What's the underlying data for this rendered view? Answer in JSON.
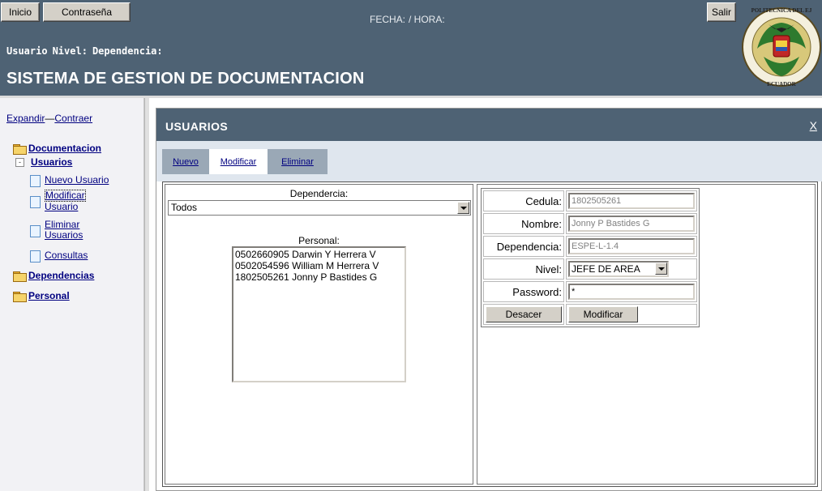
{
  "header": {
    "inicio_label": "Inicio",
    "password_label": "Contraseña",
    "fecha_label": "FECHA:",
    "hora_label": "/ HORA:",
    "salir_label": "Salir",
    "user_label": "Usuario",
    "nivel_label": "Nivel:",
    "dependencia_label": "Dependencia:",
    "system_title": "SISTEMA DE GESTION DE DOCUMENTACION",
    "logo_top_text": "POLITECNICA DEL EJ",
    "logo_bottom_text": "ECUADOR"
  },
  "sidebar": {
    "expandir": "Expandir",
    "dash": "—",
    "contraer": "Contraer",
    "documentacion": "Documentacion",
    "usuarios": "Usuarios",
    "nuevo_usuario": "Nuevo Usuario",
    "modificar": "Modificar",
    "usuario": "Usuario",
    "eliminar": "Eliminar",
    "usuarios_sub": "Usuarios",
    "consultas": "Consultas",
    "dependencias": "Dependencias",
    "personal": "Personal"
  },
  "panel": {
    "title": "USUARIOS",
    "close": "X",
    "tabs": [
      "Nuevo",
      "Modificar",
      "Eliminar"
    ],
    "active_tab": "Modificar",
    "dependencia_label": "Dependercia:",
    "dependencia_selected": "Todos",
    "personal_label": "Personal:",
    "personal_list": [
      "0502660905 Darwin Y Herrera V",
      "0502054596 William M Herrera V",
      "1802505261 Jonny P Bastides G"
    ]
  },
  "form": {
    "cedula_label": "Cedula:",
    "cedula_value": "1802505261",
    "nombre_label": "Nombre:",
    "nombre_value": "Jonny P Bastides G",
    "dependencia_label": "Dependencia:",
    "dependencia_value": "ESPE-L-1.4",
    "nivel_label": "Nivel:",
    "nivel_value": "JEFE DE AREA",
    "password_label": "Password:",
    "password_value": "*",
    "deshacer_label": "Desacer",
    "modificar_label": "Modificar"
  },
  "colors": {
    "header_bg": "#4e6274",
    "tab_bar_bg": "#dfe6ee",
    "link": "#000080"
  }
}
